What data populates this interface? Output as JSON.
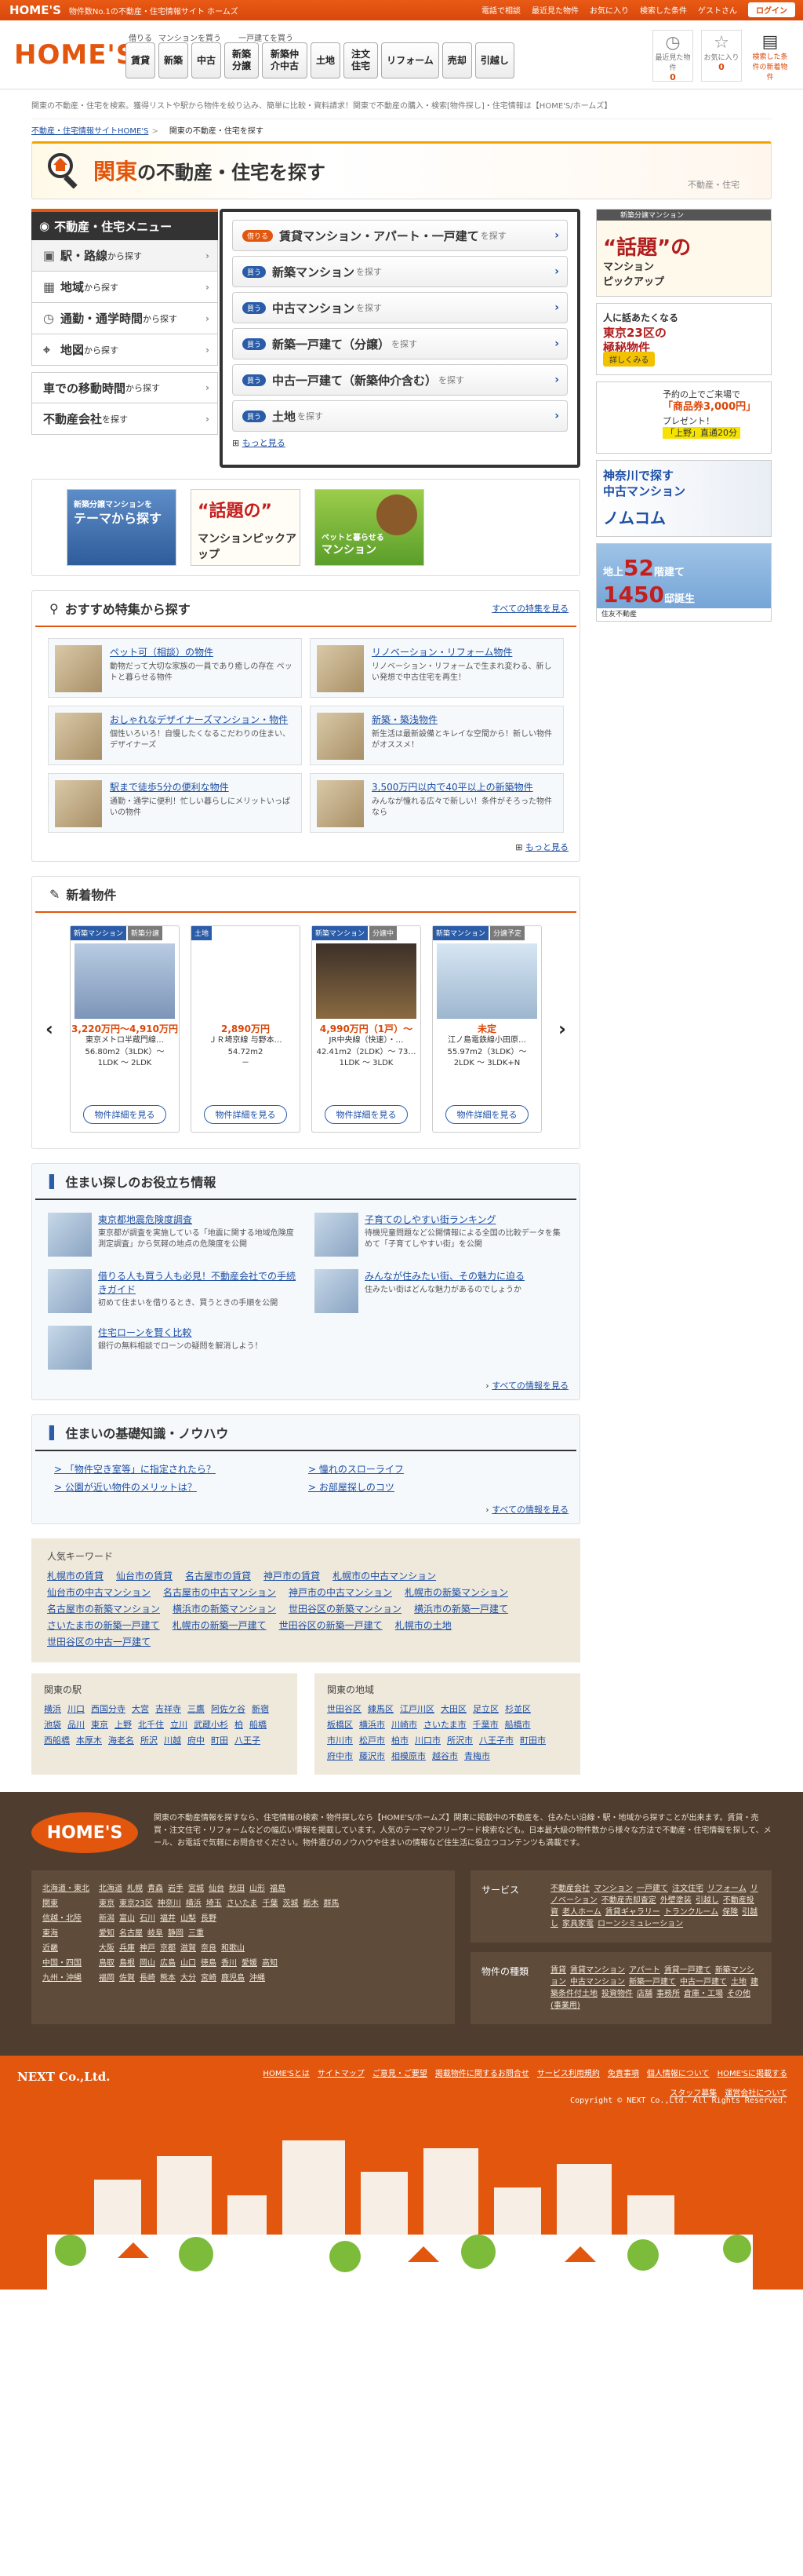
{
  "topbar": {
    "brand": "HOME'S",
    "tagline": "物件数No.1の不動産・住宅情報サイト ホームズ",
    "links": [
      "電話で相談",
      "最近見た物件",
      "お気に入り",
      "検索した条件"
    ],
    "greeting": "ゲストさん",
    "login": "ログイン"
  },
  "header": {
    "logo": "HOME'S",
    "nav_groups": [
      {
        "caption": "借りる",
        "items": [
          "賃貸"
        ]
      },
      {
        "caption": "マンションを買う",
        "items": [
          "新築",
          "中古"
        ]
      },
      {
        "caption": "一戸建てを買う",
        "items": [
          "新築分譲",
          "新築仲介中古"
        ]
      },
      {
        "caption": "",
        "items": [
          "土地",
          "注文住宅",
          "リフォーム",
          "売却",
          "引越し"
        ]
      }
    ],
    "icons": [
      {
        "icon": "clock-icon",
        "label": "最近見た物件",
        "count": "0"
      },
      {
        "icon": "star-icon",
        "label": "お気に入り",
        "count": "0"
      },
      {
        "icon": "memo-icon",
        "label": "検索した条件の新着物件",
        "count": ""
      }
    ]
  },
  "description": "関東の不動産・住宅を検索。獲得リストや駅から物件を絞り込み、簡単に比較・資料請求！関東で不動産の購入・検索[物件探し]・住宅情報は【HOME'S/ホームズ】",
  "breadcrumb": {
    "root": "不動産・住宅情報サイトHOME'S",
    "current": "関東の不動産・住宅を探す"
  },
  "banner": {
    "title_region": "関東",
    "title_rest": "の不動産・住宅を探す",
    "sub": "不動産・住宅"
  },
  "left_menu": {
    "title": "不動産・住宅メニュー",
    "items": [
      {
        "label": "駅・路線",
        "suffix": "から探す",
        "icon": "train-icon"
      },
      {
        "label": "地域",
        "suffix": "から探す",
        "icon": "map-area-icon"
      },
      {
        "label": "通勤・通学時間",
        "suffix": "から探す",
        "icon": "clock-icon"
      },
      {
        "label": "地図",
        "suffix": "から探す",
        "icon": "pin-icon"
      }
    ],
    "extra": [
      {
        "label": "車での移動時間",
        "suffix": "から探す"
      },
      {
        "label": "不動産会社",
        "suffix": "を探す"
      }
    ]
  },
  "right_menu": {
    "rows": [
      {
        "tag": "借りる",
        "label": "賃貸マンション・アパート・一戸建て",
        "suffix": "を探す"
      },
      {
        "tag": "買う",
        "label": "新築マンション",
        "suffix": "を探す"
      },
      {
        "tag": "買う",
        "label": "中古マンション",
        "suffix": "を探す"
      },
      {
        "tag": "買う",
        "label": "新築一戸建て（分譲）",
        "suffix": "を探す"
      },
      {
        "tag": "買う",
        "label": "中古一戸建て（新築仲介含む）",
        "suffix": "を探す"
      },
      {
        "tag": "買う",
        "label": "土地",
        "suffix": "を探す"
      }
    ],
    "more": "もっと見る"
  },
  "theme_banners": [
    {
      "line1": "新築分譲マンションを",
      "line2": "テーマから探す"
    },
    {
      "line1": "“話題の”",
      "line2": "マンションピックアップ"
    },
    {
      "line1": "ペットと暮らせる",
      "line2": "マンション"
    }
  ],
  "features": {
    "title": "おすすめ特集から探す",
    "all_link": "すべての特集を見る",
    "items": [
      {
        "title": "ペット可（相談）の物件",
        "desc": "動物だって大切な家族の一員であり癒しの存在 ペットと暮らせる物件"
      },
      {
        "title": "リノベーション・リフォーム物件",
        "desc": "リノベーション・リフォームで生まれ変わる、新しい発想で中古住宅を再生！"
      },
      {
        "title": "おしゃれなデザイナーズマンション・物件",
        "desc": "個性いろいろ！自慢したくなるこだわりの住まい、デザイナーズ"
      },
      {
        "title": "新築・築浅物件",
        "desc": "新生活は最新設備とキレイな空間から！新しい物件がオススメ！"
      },
      {
        "title": "駅まで徒歩5分の便利な物件",
        "desc": "通勤・通学に便利！忙しい暮らしにメリットいっぱいの物件"
      },
      {
        "title": "3,500万円以内で40平以上の新築物件",
        "desc": "みんなが憧れる広々で新しい！条件がそろった物件なら"
      }
    ],
    "more": "もっと見る"
  },
  "new_props": {
    "title": "新着物件",
    "cards": [
      {
        "tags": [
          "新築マンション",
          "新築分譲"
        ],
        "price": "3,220万円～4,910万円",
        "name": "東京メトロ半蔵門線…",
        "area": "56.80m2（3LDK）～",
        "layout": "1LDK ～ 2LDK",
        "btn": "物件詳細を見る"
      },
      {
        "tags": [
          "土地"
        ],
        "price": "2,890万円",
        "name": "ＪＲ埼京線 与野本…",
        "area": "54.72m2",
        "layout": "－",
        "btn": "物件詳細を見る"
      },
      {
        "tags": [
          "新築マンション",
          "分譲中"
        ],
        "price": "4,990万円（1戸）～",
        "name": "JR中央線（快速）・…",
        "area": "42.41m2（2LDK）～ 73…",
        "layout": "1LDK ～ 3LDK",
        "btn": "物件詳細を見る"
      },
      {
        "tags": [
          "新築マンション",
          "分譲予定"
        ],
        "price": "未定",
        "name": "江ノ島電鉄線小田原…",
        "area": "55.97m2（3LDK）～",
        "layout": "2LDK ～ 3LDK+N",
        "btn": "物件詳細を見る"
      }
    ]
  },
  "useful": {
    "title": "住まい探しのお役立ち情報",
    "all_link": "すべての情報を見る",
    "items": [
      {
        "title": "東京都地震危険度調査",
        "desc": "東京都が調査を実施している「地震に関する地域危険度測定調査」から気軽の地点の危険度を公開"
      },
      {
        "title": "子育てのしやすい街ランキング",
        "desc": "待機児童問題など公開情報による全国の比較データを集めて「子育てしやすい街」を公開"
      },
      {
        "title": "借りる人も買う人も必見！不動産会社での手続きガイド",
        "desc": "初めて住まいを借りるとき、買うときの手順を公開"
      },
      {
        "title": "みんなが住みたい街、その魅力に迫る",
        "desc": "住みたい街はどんな魅力があるのでしょうか"
      },
      {
        "title": "住宅ローンを賢く比較",
        "desc": "銀行の無料相談でローンの疑問を解消しよう！"
      }
    ]
  },
  "knowhow": {
    "title": "住まいの基礎知識・ノウハウ",
    "all_link": "すべての情報を見る",
    "items": [
      "「物件空き室等」に指定されたら？",
      "憧れのスローライフ",
      "公園が近い物件のメリットは？",
      "お部屋探しのコツ"
    ]
  },
  "keywords": {
    "title": "人気キーワード",
    "items": [
      "札幌市の賃貸",
      "仙台市の賃貸",
      "名古屋市の賃貸",
      "神戸市の賃貸",
      "札幌市の中古マンション",
      "仙台市の中古マンション",
      "名古屋市の中古マンション",
      "神戸市の中古マンション",
      "札幌市の新築マンション",
      "名古屋市の新築マンション",
      "横浜市の新築マンション",
      "世田谷区の新築マンション",
      "横浜市の新築一戸建て",
      "さいたま市の新築一戸建て",
      "札幌市の新築一戸建て",
      "世田谷区の新築一戸建て",
      "札幌市の土地",
      "世田谷区の中古一戸建て"
    ]
  },
  "stations": {
    "title": "関東の駅",
    "items": [
      "横浜",
      "川口",
      "西国分寺",
      "大宮",
      "吉祥寺",
      "三鷹",
      "阿佐ケ谷",
      "新宿",
      "池袋",
      "品川",
      "東京",
      "上野",
      "北千住",
      "立川",
      "武蔵小杉",
      "柏",
      "船橋",
      "西船橋",
      "本厚木",
      "海老名",
      "所沢",
      "川越",
      "府中",
      "町田",
      "八王子"
    ]
  },
  "regions": {
    "title": "関東の地域",
    "items": [
      "世田谷区",
      "練馬区",
      "江戸川区",
      "大田区",
      "足立区",
      "杉並区",
      "板橋区",
      "横浜市",
      "川崎市",
      "さいたま市",
      "千葉市",
      "船橋市",
      "市川市",
      "松戸市",
      "柏市",
      "川口市",
      "所沢市",
      "八王子市",
      "町田市",
      "府中市",
      "藤沢市",
      "相模原市",
      "越谷市",
      "青梅市"
    ]
  },
  "footer": {
    "logo": "HOME'S",
    "desc": "関東の不動産情報を探すなら、住宅情報の検索・物件探しなら【HOME'S/ホームズ】関東に掲載中の不動産を、住みたい沿線・駅・地域から探すことが出来ます。賃貸・売買・注文住宅・リフォームなどの幅広い情報を掲載しています。人気のテーマやフリーワード検索なども。日本最大級の物件数から様々な方法で不動産・住宅情報を探して、メール、お電話で気軽にお問合せください。物件選びのノウハウや住まいの情報など住生活に役立つコンテンツも満載です。",
    "areas": [
      {
        "k": "北海道・東北",
        "v": [
          "北海道",
          "札幌",
          "青森",
          "岩手",
          "宮城",
          "仙台",
          "秋田",
          "山形",
          "福島"
        ]
      },
      {
        "k": "関東",
        "v": [
          "東京",
          "東京23区",
          "神奈川",
          "横浜",
          "埼玉",
          "さいたま",
          "千葉",
          "茨城",
          "栃木",
          "群馬"
        ]
      },
      {
        "k": "信越・北陸",
        "v": [
          "新潟",
          "富山",
          "石川",
          "福井",
          "山梨",
          "長野"
        ]
      },
      {
        "k": "東海",
        "v": [
          "愛知",
          "名古屋",
          "岐阜",
          "静岡",
          "三重"
        ]
      },
      {
        "k": "近畿",
        "v": [
          "大阪",
          "兵庫",
          "神戸",
          "京都",
          "滋賀",
          "奈良",
          "和歌山"
        ]
      },
      {
        "k": "中国・四国",
        "v": [
          "鳥取",
          "島根",
          "岡山",
          "広島",
          "山口",
          "徳島",
          "香川",
          "愛媛",
          "高知"
        ]
      },
      {
        "k": "九州・沖縄",
        "v": [
          "福岡",
          "佐賀",
          "長崎",
          "熊本",
          "大分",
          "宮崎",
          "鹿児島",
          "沖縄"
        ]
      }
    ],
    "services": [
      {
        "k": "サービス",
        "v": [
          "不動産会社",
          "マンション",
          "一戸建て",
          "注文住宅",
          "リフォーム",
          "リノベーション",
          "不動産売却査定",
          "外壁塗装",
          "引越し",
          "不動産投資",
          "老人ホーム",
          "賃貸ギャラリー",
          "トランクルーム",
          "保険",
          "引越し",
          "家具家電",
          "ローンシミュレーション"
        ]
      },
      {
        "k": "物件の種類",
        "v": [
          "賃貸",
          "賃貸マンション",
          "アパート",
          "賃貸一戸建て",
          "新築マンション",
          "中古マンション",
          "新築一戸建て",
          "中古一戸建て",
          "土地",
          "建築条件付土地",
          "投資物件",
          "店舗",
          "事務所",
          "倉庫・工場",
          "その他(事業用)"
        ]
      }
    ]
  },
  "bottom": {
    "corp": "NEXT Co.,Ltd.",
    "links": [
      "HOME'Sとは",
      "サイトマップ",
      "ご意見・ご要望",
      "掲載物件に関するお問合せ",
      "サービス利用規約",
      "免責事項",
      "個人情報について",
      "HOME'Sに掲載する",
      "スタッフ募集",
      "運営会社について"
    ],
    "copyright": "Copyright © NEXT Co.,Ltd. All Rights Reserved."
  }
}
